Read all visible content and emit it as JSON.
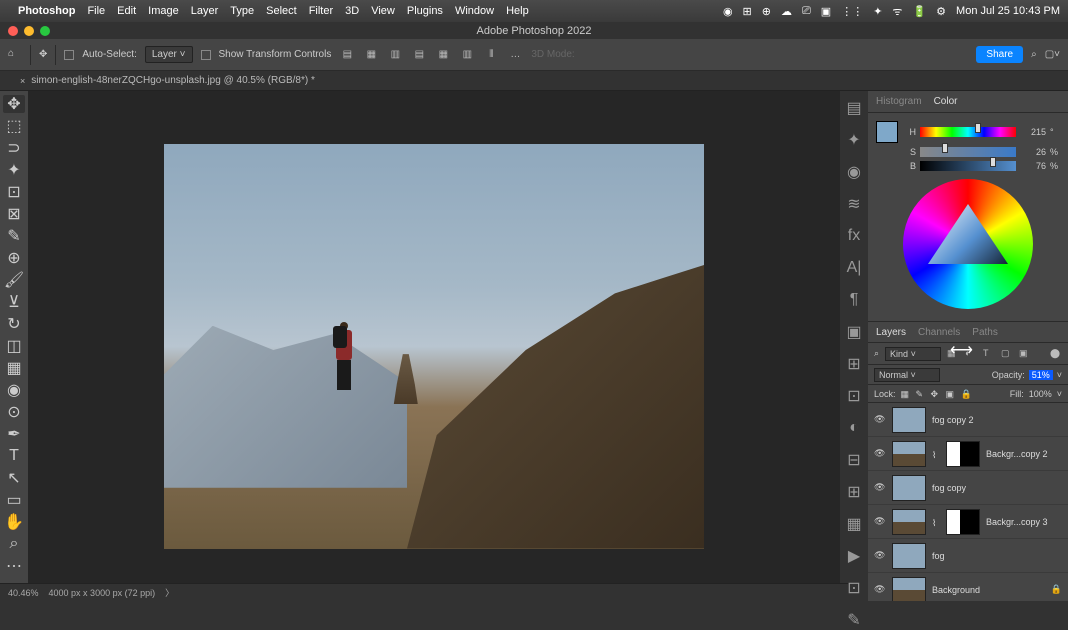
{
  "menubar": {
    "app": "Photoshop",
    "items": [
      "File",
      "Edit",
      "Image",
      "Layer",
      "Type",
      "Select",
      "Filter",
      "3D",
      "View",
      "Plugins",
      "Window",
      "Help"
    ],
    "clock": "Mon Jul 25  10:43 PM"
  },
  "window": {
    "title": "Adobe Photoshop 2022"
  },
  "options": {
    "autoselect": "Auto-Select:",
    "layer": "Layer",
    "transform": "Show Transform Controls",
    "mode3d": "3D Mode:",
    "share": "Share"
  },
  "tab": {
    "name": "simon-english-48nerZQCHgo-unsplash.jpg @ 40.5% (RGB/8*) *"
  },
  "color": {
    "tabs": [
      "Histogram",
      "Color"
    ],
    "h": {
      "label": "H",
      "value": "215",
      "unit": "°"
    },
    "s": {
      "label": "S",
      "value": "26",
      "unit": "%"
    },
    "b": {
      "label": "B",
      "value": "76",
      "unit": "%"
    }
  },
  "layers": {
    "tabs": [
      "Layers",
      "Channels",
      "Paths"
    ],
    "kind": "Kind",
    "blend": "Normal",
    "opacity_label": "Opacity:",
    "opacity": "51%",
    "fill_label": "Fill:",
    "fill": "100%",
    "lock": "Lock:",
    "items": [
      {
        "name": "fog copy 2",
        "mask": false,
        "img": false
      },
      {
        "name": "Backgr...copy 2",
        "mask": true,
        "img": true
      },
      {
        "name": "fog copy",
        "mask": false,
        "img": false
      },
      {
        "name": "Backgr...copy 3",
        "mask": true,
        "img": true
      },
      {
        "name": "fog",
        "mask": false,
        "img": false
      },
      {
        "name": "Background",
        "mask": false,
        "img": true,
        "locked": true
      }
    ]
  },
  "status": {
    "zoom": "40.46%",
    "dims": "4000 px x 3000 px (72 ppi)",
    "arrow": "〉"
  },
  "search": "⌕"
}
